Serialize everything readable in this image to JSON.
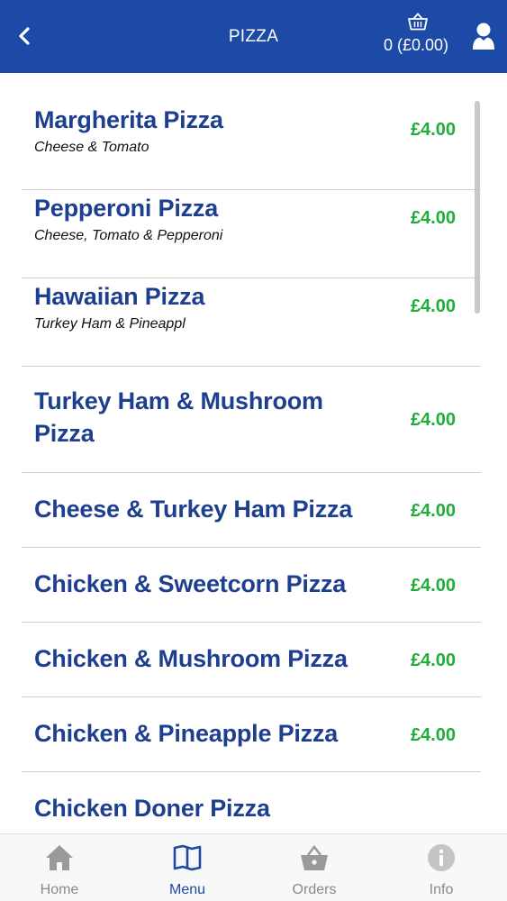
{
  "header": {
    "title": "PIZZA",
    "basket_text": "0 (£0.00)",
    "back_icon": "chevron-left-icon",
    "basket_icon": "basket-icon",
    "user_icon": "user-icon"
  },
  "menu": {
    "items": [
      {
        "name": "Margherita Pizza",
        "description": "Cheese & Tomato",
        "price": "£4.00"
      },
      {
        "name": "Pepperoni Pizza",
        "description": "Cheese, Tomato & Pepperoni",
        "price": "£4.00"
      },
      {
        "name": "Hawaiian Pizza",
        "description": "Turkey Ham & Pineappl",
        "price": "£4.00"
      },
      {
        "name": "Turkey Ham & Mushroom Pizza",
        "description": "",
        "price": "£4.00"
      },
      {
        "name": "Cheese & Turkey Ham Pizza",
        "description": "",
        "price": "£4.00"
      },
      {
        "name": "Chicken & Sweetcorn Pizza",
        "description": "",
        "price": "£4.00"
      },
      {
        "name": "Chicken & Mushroom Pizza",
        "description": "",
        "price": "£4.00"
      },
      {
        "name": "Chicken & Pineapple Pizza",
        "description": "",
        "price": "£4.00"
      },
      {
        "name": "Chicken Doner Pizza",
        "description": "",
        "price": ""
      }
    ]
  },
  "bottom_nav": {
    "items": [
      {
        "label": "Home",
        "icon": "home-icon",
        "active": false
      },
      {
        "label": "Menu",
        "icon": "menu-book-icon",
        "active": true
      },
      {
        "label": "Orders",
        "icon": "basket-icon",
        "active": false
      },
      {
        "label": "Info",
        "icon": "info-icon",
        "active": false
      }
    ]
  },
  "colors": {
    "header_bg": "#1c4aa6",
    "item_name": "#1e3f8f",
    "price": "#1fae3a",
    "nav_active": "#1c4aa6",
    "nav_inactive": "#8a8a8a"
  }
}
